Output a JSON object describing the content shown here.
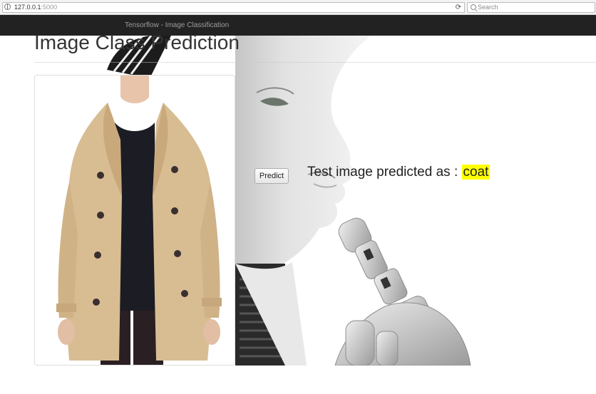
{
  "browser": {
    "url_host": "127.0.0.1",
    "url_port": ":5000",
    "reload_glyph": "⟳",
    "search_placeholder": "Search"
  },
  "navbar": {
    "brand": "Tensorflow - Image Classification"
  },
  "page": {
    "title": "Image Class Prediction"
  },
  "actions": {
    "predict_label": "Predict"
  },
  "result": {
    "prefix": "Test image predicted as : ",
    "label": "coat",
    "highlight_color": "#ffff00"
  },
  "icons": [
    "globe-icon",
    "reload-icon",
    "search-icon"
  ]
}
